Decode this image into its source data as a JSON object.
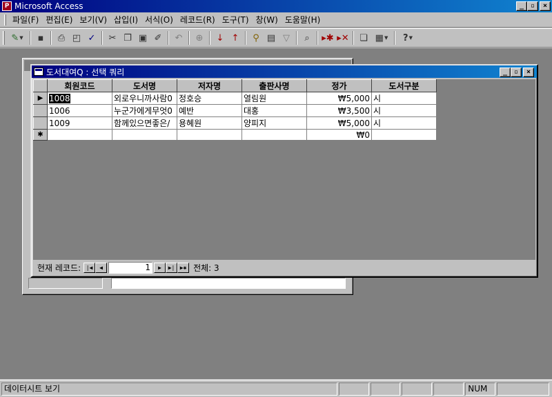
{
  "app": {
    "title": "Microsoft Access",
    "icon_letter": "P"
  },
  "window_buttons": {
    "minimize": "_",
    "restore": "▫",
    "close": "×"
  },
  "menu": [
    "파일(F)",
    "편집(E)",
    "보기(V)",
    "삽입(I)",
    "서식(O)",
    "레코드(R)",
    "도구(T)",
    "창(W)",
    "도움말(H)"
  ],
  "toolbar": {
    "icons": [
      "design-view-icon",
      "save-icon",
      "print-icon",
      "print-preview-icon",
      "spelling-icon",
      "cut-icon",
      "copy-icon",
      "paste-icon",
      "format-painter-icon",
      "undo-icon",
      "hyperlink-icon",
      "sort-ascending-icon",
      "sort-descending-icon",
      "filter-by-selection-icon",
      "filter-by-form-icon",
      "apply-filter-icon",
      "find-icon",
      "new-record-icon",
      "delete-record-icon",
      "database-window-icon",
      "new-object-icon",
      "help-icon"
    ]
  },
  "query_window": {
    "title": "도서대여Q : 선택 쿼리",
    "columns": [
      "회원코드",
      "도서명",
      "저자명",
      "출판사명",
      "정가",
      "도서구분"
    ],
    "rows": [
      {
        "selector": "▶",
        "cells": [
          "1008",
          "외로우니까사람0",
          "정호승",
          "열림원",
          "₩5,000",
          "시"
        ]
      },
      {
        "selector": "",
        "cells": [
          "1006",
          "누군가에게무엇0",
          "예반",
          "대홍",
          "₩3,500",
          "시"
        ]
      },
      {
        "selector": "",
        "cells": [
          "1009",
          "함께있으면좋은/",
          "용혜원",
          "양피지",
          "₩5,000",
          "시"
        ]
      },
      {
        "selector": "✱",
        "cells": [
          "",
          "",
          "",
          "",
          "₩0",
          ""
        ]
      }
    ],
    "nav": {
      "label": "현재 레코드:",
      "current": "1",
      "total": "전체: 3"
    }
  },
  "status_bar": {
    "text": "데이터시트 보기",
    "num": "NUM"
  }
}
